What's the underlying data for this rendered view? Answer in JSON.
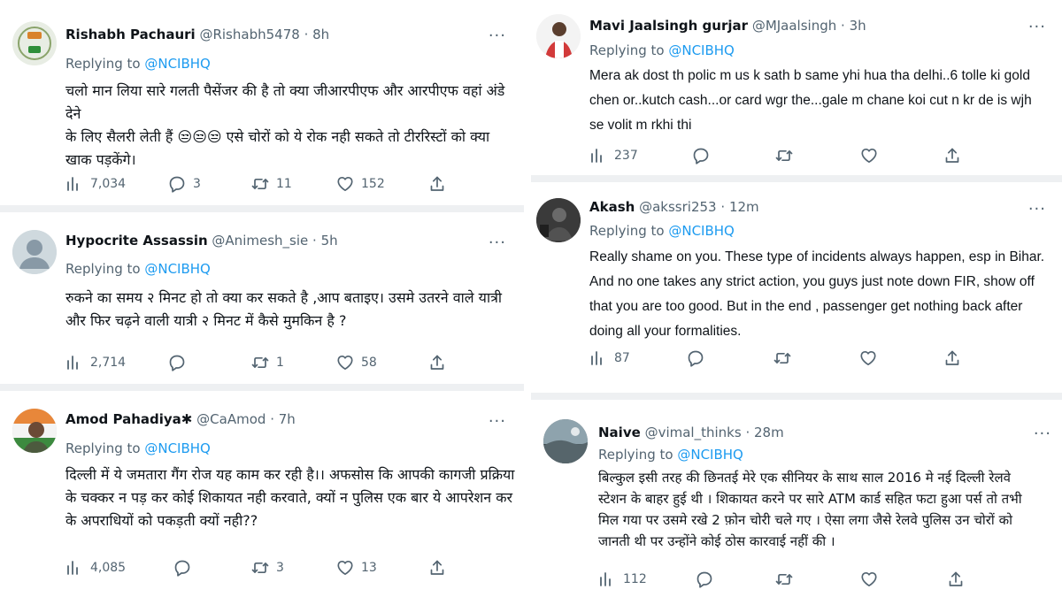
{
  "tweets": [
    {
      "name": "Rishabh Pachauri",
      "handle": "@Rishabh5478",
      "time": "8h",
      "replying_to": "Replying to",
      "mention": "@NCIBHQ",
      "text": "चलो मान लिया सारे गलती पैसेंजर की है तो क्या जीआरपीएफ और आरपीएफ वहां अंडे देने\nके लिए सैलरी लेती हैं 😒😒😒 एसे चोरों को ये रोक नही सकते तो टीररिस्टों को क्या\nखाक पड़केंगे।",
      "views": "7,034",
      "replies": "3",
      "retweets": "11",
      "likes": "152"
    },
    {
      "name": "Hypocrite Assassin",
      "handle": "@Animesh_sie",
      "time": "5h",
      "replying_to": "Replying to",
      "mention": "@NCIBHQ",
      "text": "रुकने का समय २ मिनट हो तो क्या कर सकते है ,आप बताइए। उसमे उतरने वाले यात्री\nऔर फिर चढ़ने वाली यात्री २ मिनट में कैसे मुमकिन है ?",
      "views": "2,714",
      "replies": "",
      "retweets": "1",
      "likes": "58"
    },
    {
      "name": "Amod Pahadiya✱",
      "handle": "@CaAmod",
      "time": "7h",
      "replying_to": "Replying to",
      "mention": "@NCIBHQ",
      "text": "दिल्ली में ये जमतारा गैंग रोज यह काम कर रही है।। अफसोस कि आपकी कागजी प्रक्रिया\nके चक्कर न पड़ कर कोई शिकायत नही करवाते, क्यों न पुलिस एक बार ये आपरेशन कर\nके अपराधियों को पकड़ती क्यों नही??",
      "views": "4,085",
      "replies": "",
      "retweets": "3",
      "likes": "13"
    },
    {
      "name": "Mavi Jaalsingh gurjar",
      "handle": "@MJaalsingh",
      "time": "3h",
      "replying_to": "Replying to",
      "mention": "@NCIBHQ",
      "text": "Mera ak dost th polic m us k sath b same yhi hua tha delhi..6 tolle ki gold\nchen or..kutch cash...or card wgr the...gale m chane koi cut n kr de is wjh\nse volit m rkhi thi",
      "views": "237",
      "replies": "",
      "retweets": "",
      "likes": ""
    },
    {
      "name": "Akash",
      "handle": "@akssri253",
      "time": "12m",
      "replying_to": "Replying to",
      "mention": "@NCIBHQ",
      "text": "Really shame on you. These type of incidents always happen, esp in Bihar.\nAnd no one takes any strict action, you guys just note down FIR, show off\nthat you are too good. But in the end , passenger get nothing back after\ndoing all your formalities.",
      "views": "87",
      "replies": "",
      "retweets": "",
      "likes": ""
    },
    {
      "name": "Naive",
      "handle": "@vimal_thinks",
      "time": "28m",
      "replying_to": "Replying to",
      "mention": "@NCIBHQ",
      "text": "बिल्कुल इसी तरह की छिनतई मेरे एक सीनियर के साथ साल 2016 मे नई दिल्ली रेलवे\nस्टेशन के बाहर हुई थी । शिकायत करने पर सारे ATM कार्ड सहित फटा हुआ पर्स तो तभी\nमिल गया पर उसमे रखे 2 फ़ोन चोरी चले गए । ऐसा लगा जैसे रेलवे पुलिस उन चोरों को\nजानती थी पर उन्होंने कोई ठोस कारवाई नहीं  की ।",
      "views": "112",
      "replies": "",
      "retweets": "",
      "likes": ""
    }
  ],
  "colors": {
    "mention": "#1d9bf0",
    "muted": "#536471",
    "separator": "#eef0f2"
  },
  "icons": [
    "views-icon",
    "reply-icon",
    "retweet-icon",
    "like-icon",
    "share-icon",
    "more-icon"
  ]
}
